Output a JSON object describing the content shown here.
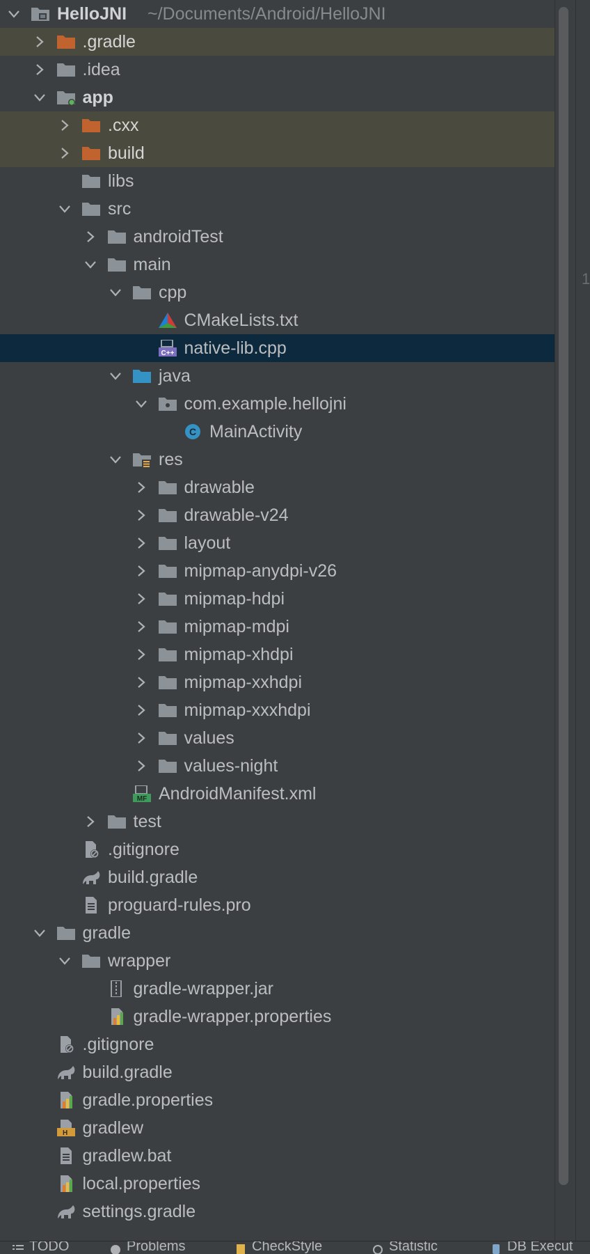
{
  "project_tree": {
    "root_path": "~/Documents/Android/HelloJNI",
    "items": [
      {
        "label": "HelloJNI",
        "depth": 0,
        "arrow": "down",
        "icon": "project-folder-icon",
        "bold": true
      },
      {
        "label": ".gradle",
        "depth": 1,
        "arrow": "right",
        "icon": "excluded-folder-icon",
        "excluded": true
      },
      {
        "label": ".idea",
        "depth": 1,
        "arrow": "right",
        "icon": "folder-icon"
      },
      {
        "label": "app",
        "depth": 1,
        "arrow": "down",
        "icon": "module-folder-icon",
        "bold": true
      },
      {
        "label": ".cxx",
        "depth": 2,
        "arrow": "right",
        "icon": "excluded-folder-icon",
        "excluded": true
      },
      {
        "label": "build",
        "depth": 2,
        "arrow": "right",
        "icon": "excluded-folder-icon",
        "excluded": true
      },
      {
        "label": "libs",
        "depth": 2,
        "arrow": "none",
        "icon": "folder-icon"
      },
      {
        "label": "src",
        "depth": 2,
        "arrow": "down",
        "icon": "folder-icon"
      },
      {
        "label": "androidTest",
        "depth": 3,
        "arrow": "right",
        "icon": "folder-icon"
      },
      {
        "label": "main",
        "depth": 3,
        "arrow": "down",
        "icon": "folder-icon"
      },
      {
        "label": "cpp",
        "depth": 4,
        "arrow": "down",
        "icon": "folder-icon"
      },
      {
        "label": "CMakeLists.txt",
        "depth": 5,
        "arrow": "none",
        "icon": "cmake-icon"
      },
      {
        "label": "native-lib.cpp",
        "depth": 5,
        "arrow": "none",
        "icon": "cpp-file-icon",
        "selected": true
      },
      {
        "label": "java",
        "depth": 4,
        "arrow": "down",
        "icon": "source-folder-icon"
      },
      {
        "label": "com.example.hellojni",
        "depth": 5,
        "arrow": "down",
        "icon": "package-icon"
      },
      {
        "label": "MainActivity",
        "depth": 6,
        "arrow": "none",
        "icon": "class-icon"
      },
      {
        "label": "res",
        "depth": 4,
        "arrow": "down",
        "icon": "resource-folder-icon"
      },
      {
        "label": "drawable",
        "depth": 5,
        "arrow": "right",
        "icon": "folder-icon"
      },
      {
        "label": "drawable-v24",
        "depth": 5,
        "arrow": "right",
        "icon": "folder-icon"
      },
      {
        "label": "layout",
        "depth": 5,
        "arrow": "right",
        "icon": "folder-icon"
      },
      {
        "label": "mipmap-anydpi-v26",
        "depth": 5,
        "arrow": "right",
        "icon": "folder-icon"
      },
      {
        "label": "mipmap-hdpi",
        "depth": 5,
        "arrow": "right",
        "icon": "folder-icon"
      },
      {
        "label": "mipmap-mdpi",
        "depth": 5,
        "arrow": "right",
        "icon": "folder-icon"
      },
      {
        "label": "mipmap-xhdpi",
        "depth": 5,
        "arrow": "right",
        "icon": "folder-icon"
      },
      {
        "label": "mipmap-xxhdpi",
        "depth": 5,
        "arrow": "right",
        "icon": "folder-icon"
      },
      {
        "label": "mipmap-xxxhdpi",
        "depth": 5,
        "arrow": "right",
        "icon": "folder-icon"
      },
      {
        "label": "values",
        "depth": 5,
        "arrow": "right",
        "icon": "folder-icon"
      },
      {
        "label": "values-night",
        "depth": 5,
        "arrow": "right",
        "icon": "folder-icon"
      },
      {
        "label": "AndroidManifest.xml",
        "depth": 4,
        "arrow": "none",
        "icon": "manifest-icon"
      },
      {
        "label": "test",
        "depth": 3,
        "arrow": "right",
        "icon": "folder-icon"
      },
      {
        "label": ".gitignore",
        "depth": 2,
        "arrow": "none",
        "icon": "gitignore-icon"
      },
      {
        "label": "build.gradle",
        "depth": 2,
        "arrow": "none",
        "icon": "gradle-icon"
      },
      {
        "label": "proguard-rules.pro",
        "depth": 2,
        "arrow": "none",
        "icon": "text-file-icon"
      },
      {
        "label": "gradle",
        "depth": 1,
        "arrow": "down",
        "icon": "folder-icon"
      },
      {
        "label": "wrapper",
        "depth": 2,
        "arrow": "down",
        "icon": "folder-icon"
      },
      {
        "label": "gradle-wrapper.jar",
        "depth": 3,
        "arrow": "none",
        "icon": "jar-icon"
      },
      {
        "label": "gradle-wrapper.properties",
        "depth": 3,
        "arrow": "none",
        "icon": "properties-icon"
      },
      {
        "label": ".gitignore",
        "depth": 1,
        "arrow": "none",
        "icon": "gitignore-icon"
      },
      {
        "label": "build.gradle",
        "depth": 1,
        "arrow": "none",
        "icon": "gradle-icon"
      },
      {
        "label": "gradle.properties",
        "depth": 1,
        "arrow": "none",
        "icon": "properties-icon"
      },
      {
        "label": "gradlew",
        "depth": 1,
        "arrow": "none",
        "icon": "shell-script-icon"
      },
      {
        "label": "gradlew.bat",
        "depth": 1,
        "arrow": "none",
        "icon": "text-file-icon"
      },
      {
        "label": "local.properties",
        "depth": 1,
        "arrow": "none",
        "icon": "properties-icon"
      },
      {
        "label": "settings.gradle",
        "depth": 1,
        "arrow": "none",
        "icon": "gradle-icon"
      }
    ]
  },
  "editor_gutter": {
    "line_number": "1"
  },
  "bottom_toolbar": {
    "tools": [
      {
        "label": "TODO",
        "icon": "list-icon"
      },
      {
        "label": "Problems",
        "icon": "info-icon"
      },
      {
        "label": "CheckStyle",
        "icon": "checkstyle-icon"
      },
      {
        "label": "Statistic",
        "icon": "statistic-icon"
      },
      {
        "label": "DB Execut",
        "icon": "db-icon"
      }
    ]
  },
  "colors": {
    "background": "#3c3f41",
    "selection": "#0d293e",
    "excluded_row": "#4b4a3e",
    "folder": "#8b9298",
    "excluded_folder": "#c0632f",
    "source_folder": "#3592c4"
  }
}
